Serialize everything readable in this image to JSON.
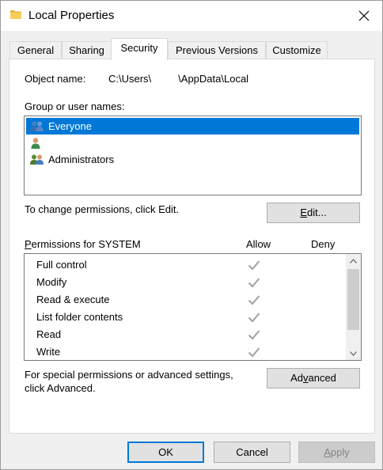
{
  "window": {
    "title": "Local Properties",
    "title_icon": "folder-icon",
    "close_icon": "close-icon"
  },
  "tabs": [
    {
      "label": "General",
      "active": false
    },
    {
      "label": "Sharing",
      "active": false
    },
    {
      "label": "Security",
      "active": true
    },
    {
      "label": "Previous Versions",
      "active": false
    },
    {
      "label": "Customize",
      "active": false
    }
  ],
  "security": {
    "object_label": "Object name:",
    "object_path_prefix": "C:\\Users\\",
    "object_path_suffix": "\\AppData\\Local",
    "group_label": "Group or user names:",
    "groups": [
      {
        "label": "Everyone",
        "icon": "group-users-icon",
        "selected": true
      },
      {
        "label": "",
        "icon": "user-icon",
        "selected": false
      },
      {
        "label": "Administrators",
        "icon": "group-users-icon",
        "selected": false
      }
    ],
    "change_text": "To change permissions, click Edit.",
    "edit_button": {
      "pre": "",
      "accel": "E",
      "post": "dit..."
    },
    "permissions_label_accel": "P",
    "permissions_label_rest": "ermissions for SYSTEM",
    "allow_label": "Allow",
    "deny_label": "Deny",
    "permissions": [
      {
        "name": "Full control",
        "allow": true,
        "deny": false
      },
      {
        "name": "Modify",
        "allow": true,
        "deny": false
      },
      {
        "name": "Read & execute",
        "allow": true,
        "deny": false
      },
      {
        "name": "List folder contents",
        "allow": true,
        "deny": false
      },
      {
        "name": "Read",
        "allow": true,
        "deny": false
      },
      {
        "name": "Write",
        "allow": true,
        "deny": false
      }
    ],
    "special_text_line1": "For special permissions or advanced settings,",
    "special_text_line2": "click Advanced.",
    "advanced_button": {
      "pre": "Ad",
      "accel": "v",
      "post": "anced"
    }
  },
  "footer": {
    "ok_label": "OK",
    "cancel_label": "Cancel",
    "apply_pre": "",
    "apply_accel": "A",
    "apply_post": "pply"
  },
  "colors": {
    "selection": "#0078d7",
    "check_gray": "#a0a0a0"
  }
}
